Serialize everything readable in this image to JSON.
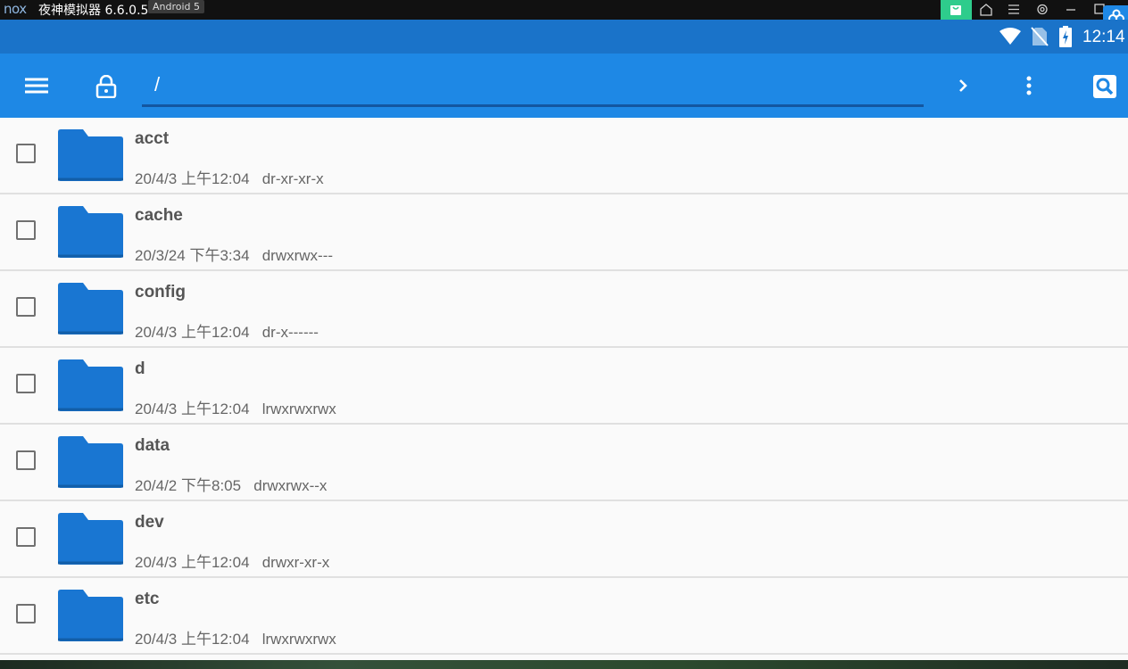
{
  "emulator": {
    "logo": "nox",
    "title": "夜神模拟器 6.6.0.5",
    "badge": "Android 5",
    "controls": [
      "store-icon",
      "home-icon",
      "menu-icon",
      "settings-icon",
      "minimize-icon",
      "maximize-icon"
    ]
  },
  "status_bar": {
    "time": "12:14",
    "icons": [
      "wifi-icon",
      "no-sim-icon",
      "battery-charging-icon"
    ]
  },
  "toolbar": {
    "path": "/",
    "icons": [
      "menu-icon",
      "lock-icon",
      "chevron-right-icon",
      "more-vert-icon",
      "search-icon"
    ]
  },
  "files": [
    {
      "name": "acct",
      "meta": "20/4/3 上午12:04   dr-xr-xr-x"
    },
    {
      "name": "cache",
      "meta": "20/3/24 下午3:34   drwxrwx---"
    },
    {
      "name": "config",
      "meta": "20/4/3 上午12:04   dr-x------"
    },
    {
      "name": "d",
      "meta": "20/4/3 上午12:04   lrwxrwxrwx"
    },
    {
      "name": "data",
      "meta": "20/4/2 下午8:05   drwxrwx--x"
    },
    {
      "name": "dev",
      "meta": "20/4/3 上午12:04   drwxr-xr-x"
    },
    {
      "name": "etc",
      "meta": "20/4/3 上午12:04   lrwxrwxrwx"
    }
  ],
  "colors": {
    "toolbar": "#1e88e5",
    "status_bar": "#1a73c9",
    "folder": "#1976d2",
    "list_bg": "#fafafa"
  }
}
